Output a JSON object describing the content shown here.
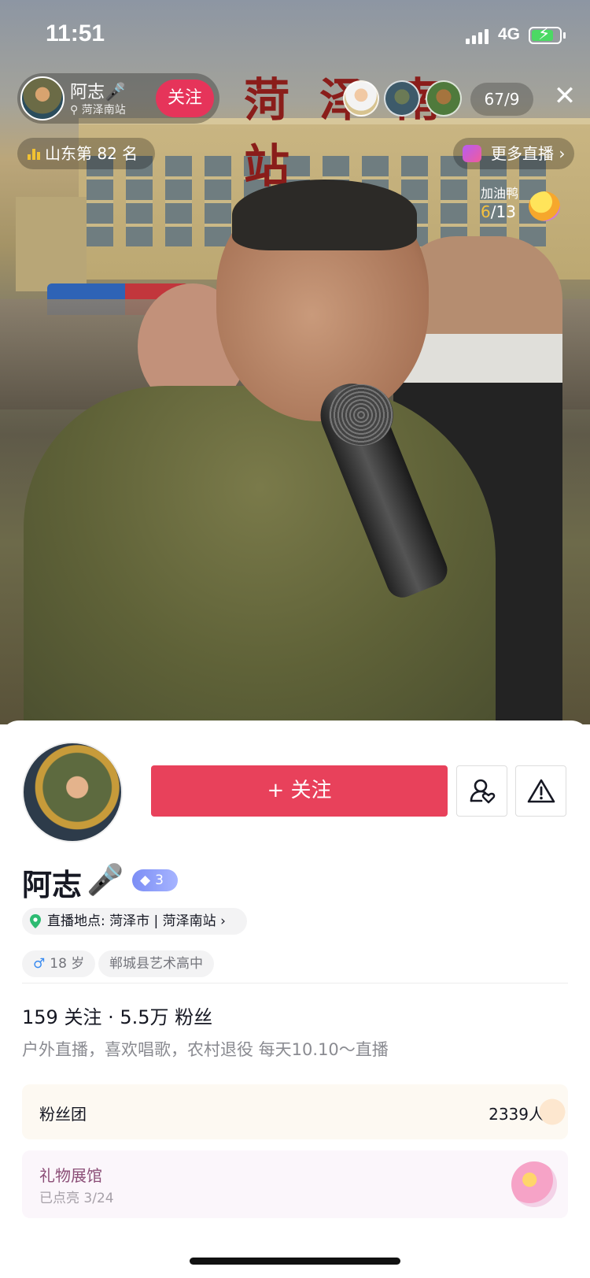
{
  "status_bar": {
    "time": "11:51",
    "network": "4G",
    "battery_level": 0.8
  },
  "stream": {
    "station_sign": "菏泽南站",
    "anchor_name": "阿志🎤",
    "anchor_location": "菏泽南站",
    "follow_label": "关注",
    "viewer_count": "67/9",
    "rank_label": "山东第 82 名",
    "more_live_label": "更多直播",
    "duck_label": "加油鸭",
    "duck_progress_current": "6",
    "duck_progress_total": "/13"
  },
  "profile": {
    "follow_button_label": "+ 关注",
    "nickname": "阿志",
    "level": "3",
    "location": "直播地点: 菏泽市 | 菏泽南站",
    "age": "18 岁",
    "school": "郸城县艺术高中",
    "stats": "159 关注 · 5.5万 粉丝",
    "bio": "户外直播，喜欢唱歌，农村退役 每天10.10～直播",
    "fan_club_label": "粉丝团",
    "fan_club_count": "2339人",
    "gift_hall_label": "礼物展馆",
    "gift_hall_progress": "已点亮 3/24"
  },
  "icons": {
    "close": "close-icon",
    "share": "person-heart-icon",
    "report": "warning-icon",
    "pin": "location-pin-icon"
  },
  "colors": {
    "accent": "#e8415b",
    "follow_pill": "#e6345a",
    "location_pin": "#2dbb72",
    "male": "#3a8bf0"
  }
}
